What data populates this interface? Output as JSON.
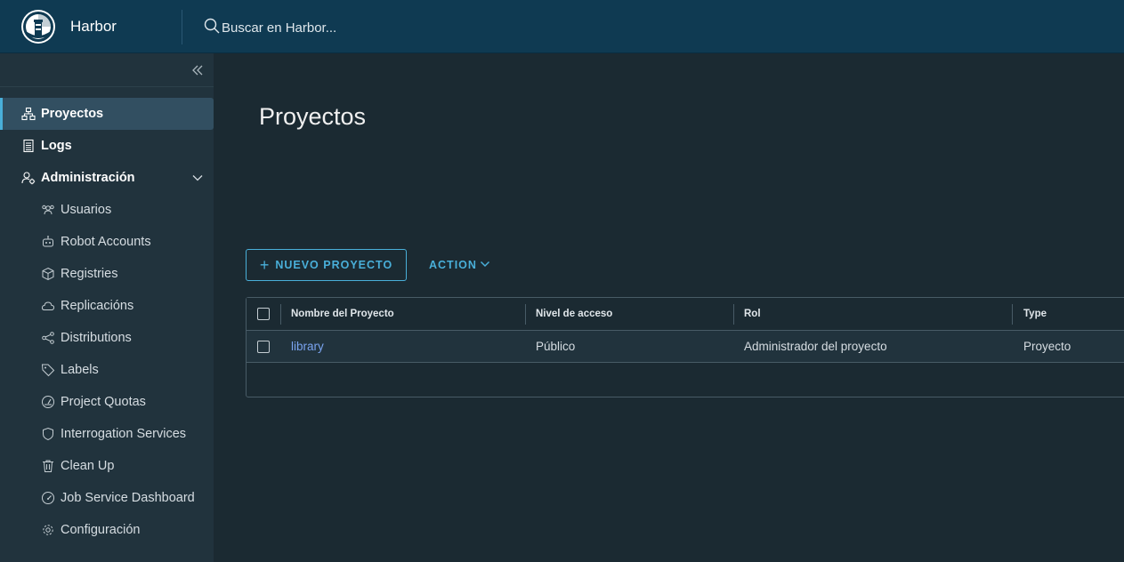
{
  "header": {
    "app_title": "Harbor",
    "search_placeholder": "Buscar en Harbor..."
  },
  "sidebar": {
    "items": [
      {
        "label": "Proyectos",
        "icon": "project-icon",
        "active": true
      },
      {
        "label": "Logs",
        "icon": "logs-icon"
      },
      {
        "label": "Administración",
        "icon": "admin-icon",
        "expanded": true
      }
    ],
    "sub_items": [
      {
        "label": "Usuarios",
        "icon": "users-icon"
      },
      {
        "label": "Robot Accounts",
        "icon": "robot-icon"
      },
      {
        "label": "Registries",
        "icon": "registries-icon"
      },
      {
        "label": "Replicacións",
        "icon": "cloud-icon"
      },
      {
        "label": "Distributions",
        "icon": "share-icon"
      },
      {
        "label": "Labels",
        "icon": "tag-icon"
      },
      {
        "label": "Project Quotas",
        "icon": "gauge-icon"
      },
      {
        "label": "Interrogation Services",
        "icon": "shield-icon"
      },
      {
        "label": "Clean Up",
        "icon": "trash-icon"
      },
      {
        "label": "Job Service Dashboard",
        "icon": "dashboard-icon"
      },
      {
        "label": "Configuración",
        "icon": "gear-icon"
      }
    ]
  },
  "main": {
    "title": "Proyectos",
    "new_project_label": "NUEVO PROYECTO",
    "action_label": "ACTION",
    "table": {
      "columns": [
        "Nombre del Proyecto",
        "Nivel de acceso",
        "Rol",
        "Type"
      ],
      "rows": [
        [
          "library",
          "Público",
          "Administrador del proyecto",
          "Proyecto"
        ]
      ]
    }
  },
  "colors": {
    "header_bg": "#0f3a52",
    "sidebar_bg": "#21333d",
    "main_bg": "#1b2a32",
    "accent": "#49afd9",
    "link": "#7aa4f0"
  }
}
